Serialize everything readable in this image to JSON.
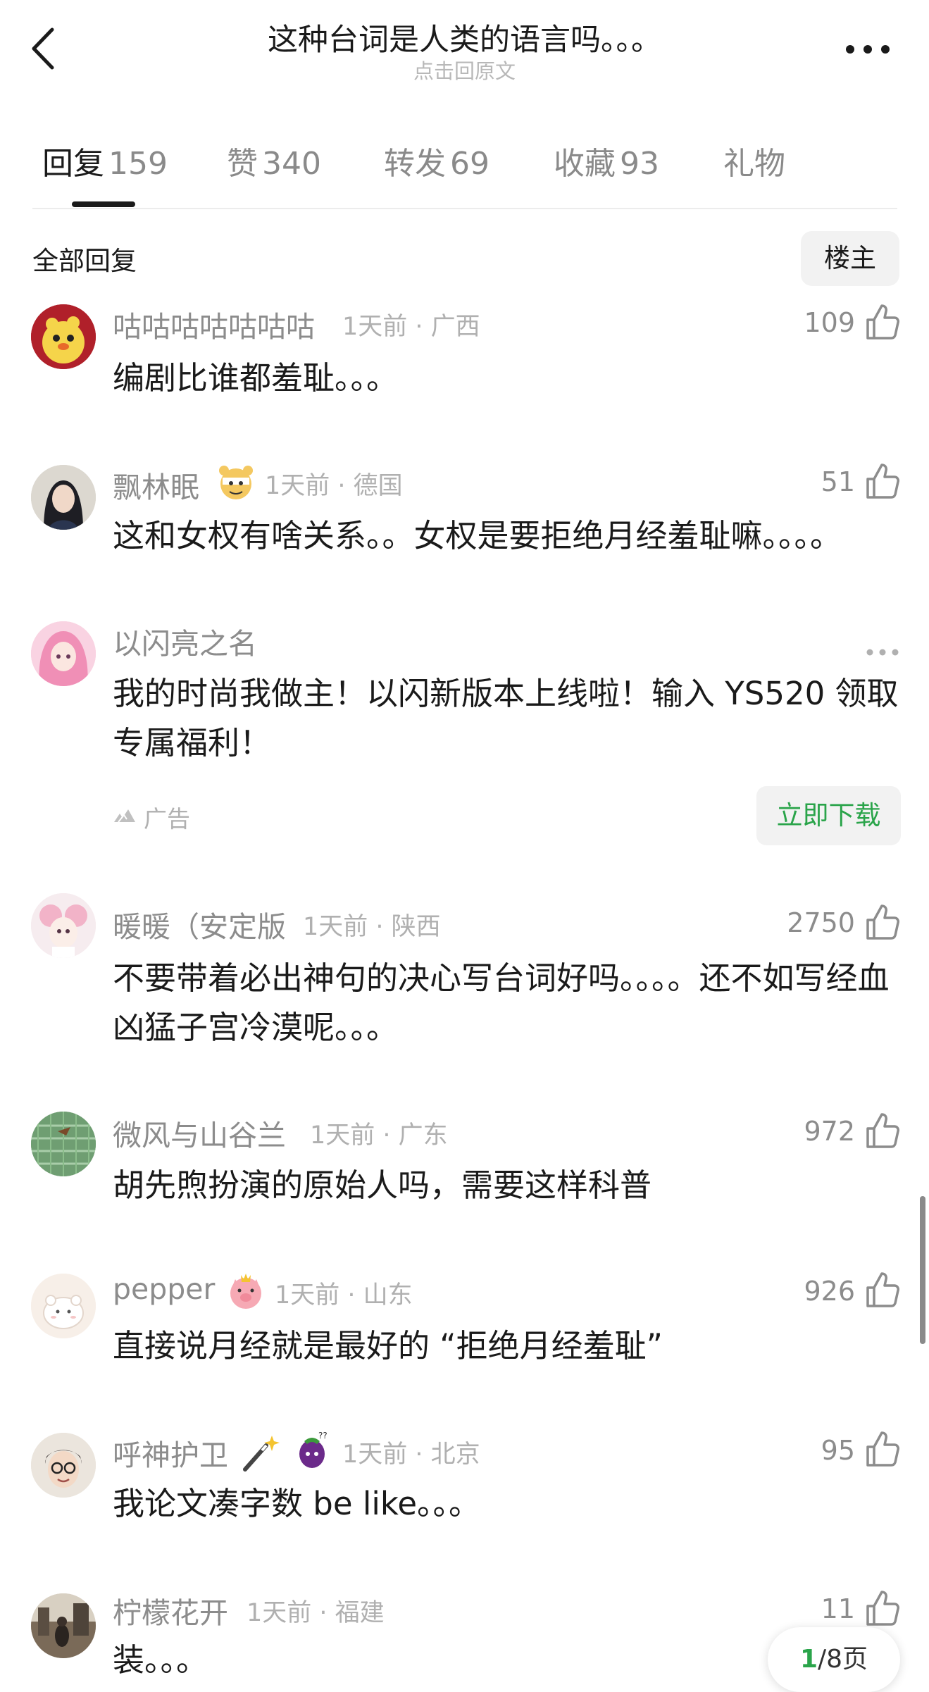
{
  "header": {
    "title": "这种台词是人类的语言吗。。。",
    "subtitle": "点击回原文"
  },
  "tabs": [
    {
      "label": "回复",
      "count": "159",
      "active": true
    },
    {
      "label": "赞",
      "count": "340",
      "active": false
    },
    {
      "label": "转发",
      "count": "69",
      "active": false
    },
    {
      "label": "收藏",
      "count": "93",
      "active": false
    },
    {
      "label": "礼物",
      "count": "",
      "active": false
    }
  ],
  "section": {
    "all_replies": "全部回复",
    "op_button": "楼主"
  },
  "comments": [
    {
      "name": "咕咕咕咕咕咕咕",
      "time_loc": "1天前 · 广西",
      "likes": "109",
      "text": "编剧比谁都羞耻。。。",
      "avatar": "yellow-chick-avatar"
    },
    {
      "name": "飘林眠",
      "time_loc": "1天前 · 德国",
      "likes": "51",
      "text": "这和女权有啥关系。。女权是要拒绝月经羞耻嘛。。。。",
      "avatar": "woman-portrait-avatar",
      "badge": "tiger-badge-icon"
    },
    {
      "name": "暖暖（安定版",
      "time_loc": "1天前 · 陕西",
      "likes": "2750",
      "text": "不要带着必出神句的决心写台词好吗。。。。还不如写经血凶猛子宫冷漠呢。。。",
      "avatar": "pink-doll-avatar"
    },
    {
      "name": "微风与山谷兰",
      "time_loc": "1天前 · 广东",
      "likes": "972",
      "text": "胡先煦扮演的原始人吗，需要这样科普",
      "avatar": "green-leaf-avatar"
    },
    {
      "name": "pepper",
      "time_loc": "1天前 · 山东",
      "likes": "926",
      "text": "直接说月经就是最好的 “拒绝月经羞耻”",
      "avatar": "white-bear-avatar",
      "badge": "pig-badge-icon"
    },
    {
      "name": "呼神护卫",
      "time_loc": "1天前 · 北京",
      "likes": "95",
      "text": "我论文凑字数 be like。。。",
      "avatar": "glasses-man-avatar",
      "badge": "eggplant-badge-icon"
    },
    {
      "name": "柠檬花开",
      "time_loc": "1天前 · 福建",
      "likes": "11",
      "text": "装。。。",
      "avatar": "street-photo-avatar"
    }
  ],
  "ad": {
    "name": "以闪亮之名",
    "text": "我的时尚我做主！以闪新版本上线啦！输入 YS520 领取专属福利！",
    "label": "广告",
    "button": "立即下载"
  },
  "pager": {
    "current": "1",
    "total": "/8页"
  },
  "colors": {
    "accent_green": "#2aa44a",
    "text_primary": "#1a1a1a",
    "text_secondary": "#8c8c8c"
  }
}
